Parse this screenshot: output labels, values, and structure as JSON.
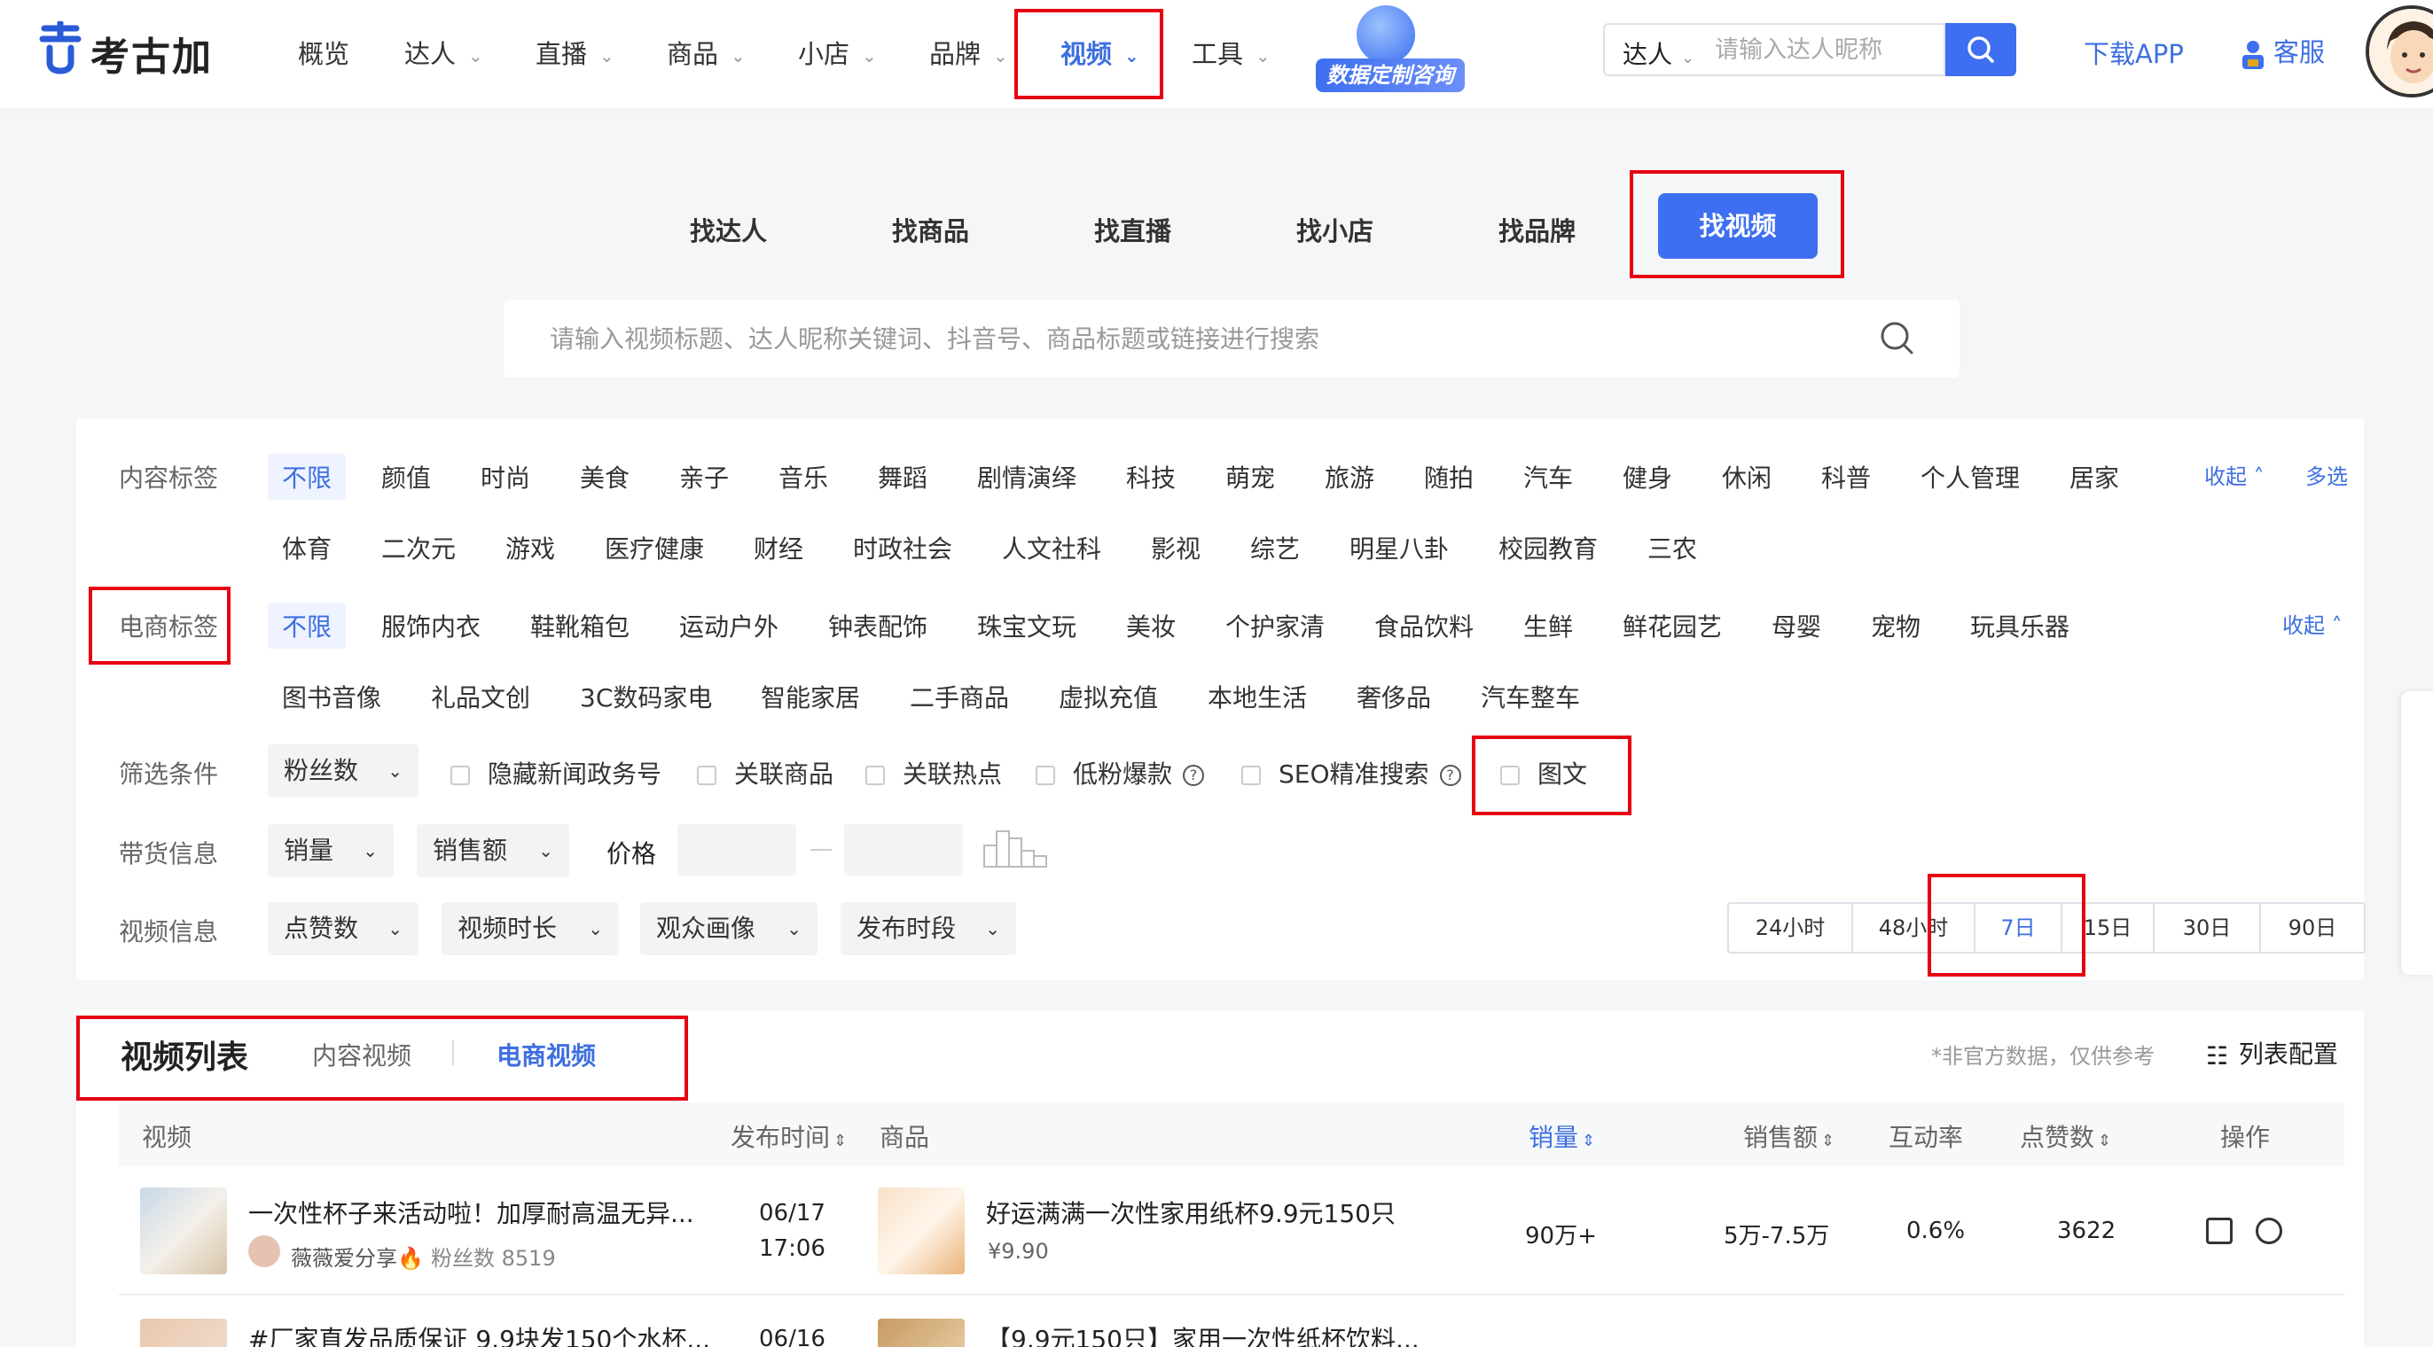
{
  "brand": {
    "name": "考古加",
    "accent": "#3d6ff0",
    "highlight": "#e60012"
  },
  "nav": {
    "items": [
      {
        "label": "概览"
      },
      {
        "label": "达人"
      },
      {
        "label": "直播"
      },
      {
        "label": "商品"
      },
      {
        "label": "小店"
      },
      {
        "label": "品牌"
      },
      {
        "label": "视频"
      },
      {
        "label": "工具"
      }
    ],
    "active": "视频",
    "promo_label": "数据定制咨询",
    "search": {
      "type": "达人",
      "placeholder": "请输入达人昵称"
    },
    "download_label": "下载APP",
    "service_label": "客服"
  },
  "category_tabs": [
    "找达人",
    "找商品",
    "找直播",
    "找小店",
    "找品牌",
    "找视频"
  ],
  "category_active": "找视频",
  "main_search": {
    "placeholder": "请输入视频标题、达人昵称关键词、抖音号、商品标题或链接进行搜索"
  },
  "filters": {
    "content_tags": {
      "label": "内容标签",
      "items": [
        "不限",
        "颜值",
        "时尚",
        "美食",
        "亲子",
        "音乐",
        "舞蹈",
        "剧情演绎",
        "科技",
        "萌宠",
        "旅游",
        "随拍",
        "汽车",
        "健身",
        "休闲",
        "科普",
        "个人管理",
        "居家",
        "体育",
        "二次元",
        "游戏",
        "医疗健康",
        "财经",
        "时政社会",
        "人文社科",
        "影视",
        "综艺",
        "明星八卦",
        "校园教育",
        "三农"
      ],
      "collapse_label": "收起",
      "multi_label": "多选"
    },
    "ecommerce_tags": {
      "label": "电商标签",
      "items": [
        "不限",
        "服饰内衣",
        "鞋靴箱包",
        "运动户外",
        "钟表配饰",
        "珠宝文玩",
        "美妆",
        "个护家清",
        "食品饮料",
        "生鲜",
        "鲜花园艺",
        "母婴",
        "宠物",
        "玩具乐器",
        "图书音像",
        "礼品文创",
        "3C数码家电",
        "智能家居",
        "二手商品",
        "虚拟充值",
        "本地生活",
        "奢侈品",
        "汽车整车"
      ],
      "collapse_label": "收起"
    },
    "conditions": {
      "label": "筛选条件",
      "dropdown": "粉丝数",
      "checkboxes": [
        "隐藏新闻政务号",
        "关联商品",
        "关联热点",
        "低粉爆款",
        "SEO精准搜索",
        "图文"
      ]
    },
    "sales_info": {
      "label": "带货信息",
      "dropdowns": [
        "销量",
        "销售额"
      ],
      "price_label": "价格"
    },
    "video_info": {
      "label": "视频信息",
      "dropdowns": [
        "点赞数",
        "视频时长",
        "观众画像",
        "发布时段"
      ],
      "time_ranges": [
        "24小时",
        "48小时",
        "7日",
        "15日",
        "30日",
        "90日"
      ],
      "time_active": "7日"
    }
  },
  "list": {
    "title": "视频列表",
    "tabs": [
      "内容视频",
      "电商视频"
    ],
    "active_tab": "电商视频",
    "disclaimer": "*非官方数据，仅供参考",
    "config_label": "列表配置",
    "columns": [
      "视频",
      "发布时间",
      "商品",
      "销量",
      "销售额",
      "互动率",
      "点赞数",
      "操作"
    ],
    "rows": [
      {
        "video_title": "一次性杯子来活动啦！加厚耐高温无异...",
        "author": "薇薇爱分享🔥",
        "fans_label": "粉丝数",
        "fans": "8519",
        "date": "06/17",
        "time": "17:06",
        "product_title": "好运满满一次性家用纸杯9.9元150只",
        "price": "¥9.90",
        "sales": "90万+",
        "revenue": "5万-7.5万",
        "interaction": "0.6%",
        "likes": "3622"
      },
      {
        "video_title": "#厂家直发品质保证 9.9块发150个水杯...",
        "date": "06/16",
        "product_title": "【9.9元150只】家用一次性纸杯饮料..."
      }
    ]
  }
}
